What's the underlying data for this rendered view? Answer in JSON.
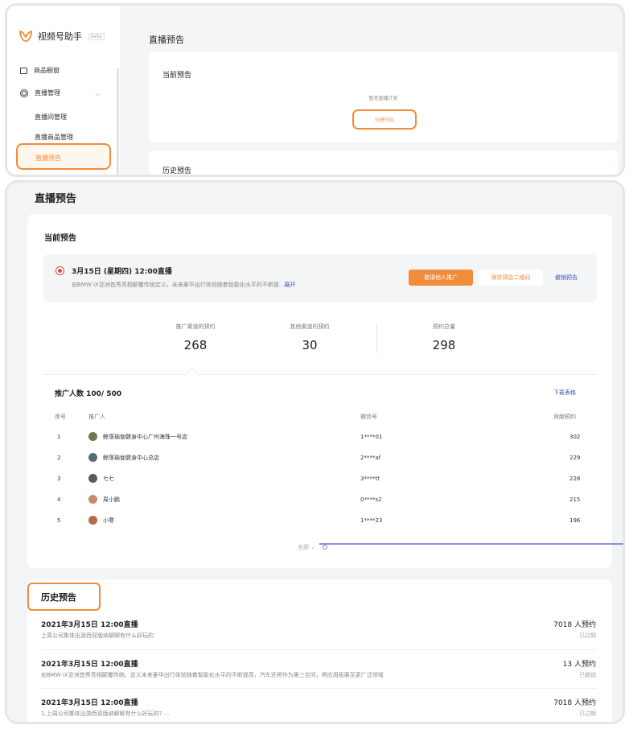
{
  "top_window": {
    "app_name": "视频号助手",
    "badge": "beta",
    "nav": [
      {
        "label": "商品橱窗"
      },
      {
        "label": "直播管理"
      }
    ],
    "sub_nav": [
      {
        "label": "直播间管理"
      },
      {
        "label": "直播商品管理"
      },
      {
        "label": "直播预告"
      }
    ],
    "title": "直播预告",
    "current_heading": "当前预告",
    "empty_text": "暂无直播计划",
    "create_button": "创建预告",
    "history_heading": "历史预告"
  },
  "main": {
    "title": "直播预告",
    "current": {
      "heading": "当前预告",
      "live": {
        "date": "3月15日 (星期四) 12:00直播",
        "desc": "创BMW iX亚洲首秀亮相颠覆传统定义，未来豪华出行体验随着智能化水平的不断提...",
        "more": "展开",
        "invite_button": "邀请他人推广",
        "save_button": "保存预告二维码",
        "cancel_button": "撤销预告"
      },
      "stats": [
        {
          "label": "推广渠道的预约",
          "value": "268"
        },
        {
          "label": "其他渠道的预约",
          "value": "30"
        },
        {
          "label": "预约总量",
          "value": "298"
        }
      ],
      "promoters": {
        "heading": "推广人数 100/ 500",
        "download": "下载表格",
        "columns": [
          "序号",
          "推广人",
          "微信号",
          "贡献预约"
        ],
        "rows": [
          {
            "idx": "1",
            "name": "鲸落瑜伽健身中心广州海珠一号店",
            "wechat": "1****01",
            "count": "302"
          },
          {
            "idx": "2",
            "name": "鲸落瑜伽健身中心总店",
            "wechat": "2****af",
            "count": "229"
          },
          {
            "idx": "3",
            "name": "七七",
            "wechat": "3****tt",
            "count": "228"
          },
          {
            "idx": "4",
            "name": "周小鹏",
            "wechat": "0****s2",
            "count": "215"
          },
          {
            "idx": "5",
            "name": "小寒",
            "wechat": "1****23",
            "count": "196"
          }
        ],
        "all": "全部"
      }
    },
    "history": {
      "heading": "历史预告",
      "items": [
        {
          "title": "2021年3月15日 12:00直播",
          "desc": "上周公司集体出游西双版纳聊聊有什么好玩的",
          "count": "7018 人预约",
          "status": "已过期"
        },
        {
          "title": "2021年3月15日 12:00直播",
          "desc": "创BMW iX亚洲首秀亮相颠覆传统。定义未来豪华出行体验随着智能化水平的不断提高，汽车还将作为第三空间，将应用拓展至更广泛领域",
          "count": "13 人预约",
          "status": "已撤销"
        },
        {
          "title": "2021年3月15日 12:00直播",
          "desc": "1.上周公司集体出游西双版纳聊聊有什么好玩的? ...",
          "count": "7018 人预约",
          "status": "已过期"
        }
      ]
    }
  },
  "colors": {
    "accent": "#f08c3c",
    "link": "#3b5bb5",
    "live_dot": "#e8453c"
  },
  "icons": [
    "logo-icon",
    "box-icon",
    "target-icon",
    "chevron-down-icon",
    "live-radio-icon"
  ]
}
